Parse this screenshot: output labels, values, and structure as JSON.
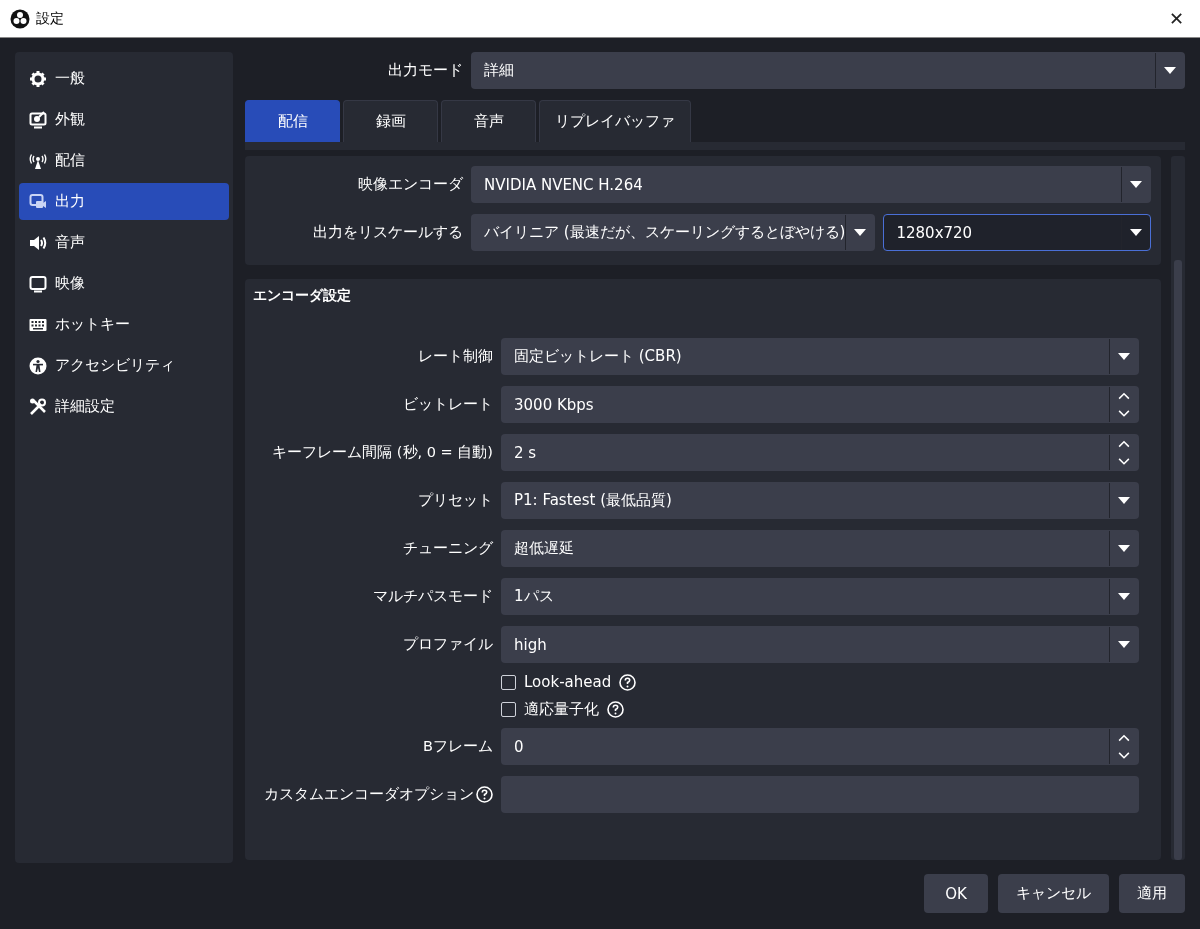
{
  "window": {
    "title": "設定",
    "close": "✕"
  },
  "sidebar": {
    "items": [
      {
        "label": "一般",
        "selected": false
      },
      {
        "label": "外観",
        "selected": false
      },
      {
        "label": "配信",
        "selected": false
      },
      {
        "label": "出力",
        "selected": true
      },
      {
        "label": "音声",
        "selected": false
      },
      {
        "label": "映像",
        "selected": false
      },
      {
        "label": "ホットキー",
        "selected": false
      },
      {
        "label": "アクセシビリティ",
        "selected": false
      },
      {
        "label": "詳細設定",
        "selected": false
      }
    ]
  },
  "output_mode": {
    "label": "出力モード",
    "value": "詳細"
  },
  "tabs": [
    {
      "label": "配信",
      "selected": true
    },
    {
      "label": "録画",
      "selected": false
    },
    {
      "label": "音声",
      "selected": false
    },
    {
      "label": "リプレイバッファ",
      "selected": false
    }
  ],
  "stream": {
    "encoder": {
      "label": "映像エンコーダ",
      "value": "NVIDIA NVENC H.264"
    },
    "rescale": {
      "label": "出力をリスケールする",
      "method": "バイリニア (最速だが、スケーリングするとぼやける)",
      "resolution": "1280x720",
      "resolution_focused": true
    }
  },
  "encoder_settings": {
    "title": "エンコーダ設定",
    "fields": [
      {
        "kind": "select",
        "label": "レート制御",
        "value": "固定ビットレート (CBR)"
      },
      {
        "kind": "spin",
        "label": "ビットレート",
        "value": "3000 Kbps"
      },
      {
        "kind": "spin",
        "label": "キーフレーム間隔 (秒, 0 = 自動)",
        "value": "2 s"
      },
      {
        "kind": "select",
        "label": "プリセット",
        "value": "P1: Fastest (最低品質)"
      },
      {
        "kind": "select",
        "label": "チューニング",
        "value": "超低遅延"
      },
      {
        "kind": "select",
        "label": "マルチパスモード",
        "value": "1パス"
      },
      {
        "kind": "select",
        "label": "プロファイル",
        "value": "high"
      },
      {
        "kind": "checkbox",
        "label": "Look-ahead",
        "checked": false,
        "help": true
      },
      {
        "kind": "checkbox",
        "label": "適応量子化",
        "checked": false,
        "help": true
      },
      {
        "kind": "spin",
        "label": "Bフレーム",
        "value": "0"
      },
      {
        "kind": "text",
        "label": "カスタムエンコーダオプション",
        "help": true
      }
    ]
  },
  "buttons": [
    "OK",
    "キャンセル",
    "適用"
  ]
}
